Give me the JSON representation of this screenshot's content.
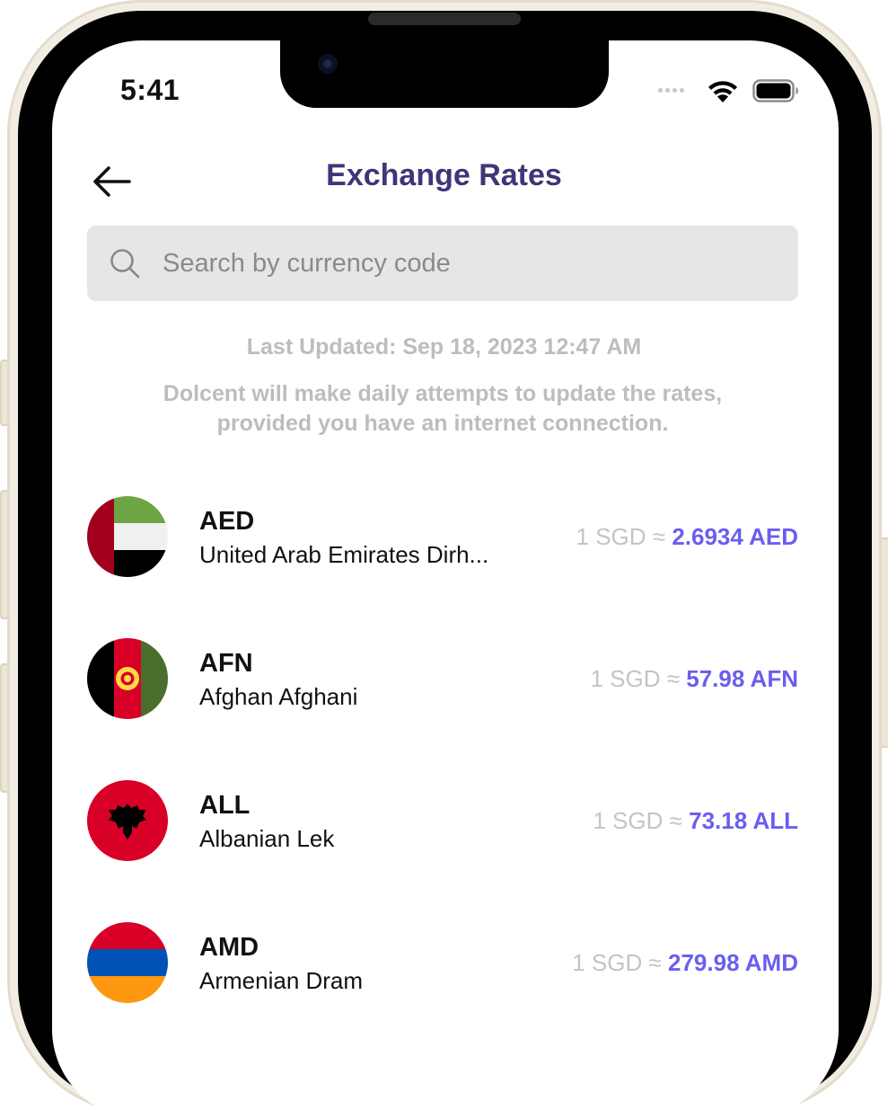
{
  "status_bar": {
    "time": "5:41"
  },
  "header": {
    "title": "Exchange Rates"
  },
  "search": {
    "placeholder": "Search by currency code",
    "value": ""
  },
  "info": {
    "last_updated": "Last Updated: Sep 18, 2023 12:47 AM",
    "note": "Dolcent will make daily attempts to update the rates, provided you have an internet connection."
  },
  "rates": [
    {
      "code": "AED",
      "name": "United Arab Emirates Dirh...",
      "base": "1 SGD",
      "approx": "≈",
      "value": "2.6934 AED"
    },
    {
      "code": "AFN",
      "name": "Afghan Afghani",
      "base": "1 SGD",
      "approx": "≈",
      "value": "57.98 AFN"
    },
    {
      "code": "ALL",
      "name": "Albanian Lek",
      "base": "1 SGD",
      "approx": "≈",
      "value": "73.18 ALL"
    },
    {
      "code": "AMD",
      "name": "Armenian Dram",
      "base": "1 SGD",
      "approx": "≈",
      "value": "279.98 AMD"
    }
  ],
  "colors": {
    "title": "#3f3579",
    "rate_value": "#6a5ef0",
    "muted": "#bdbdbd",
    "search_bg": "#e6e6e6"
  },
  "icons": {
    "back": "arrow-left-icon",
    "search": "magnifier-icon",
    "wifi": "wifi-icon",
    "battery": "battery-icon"
  }
}
